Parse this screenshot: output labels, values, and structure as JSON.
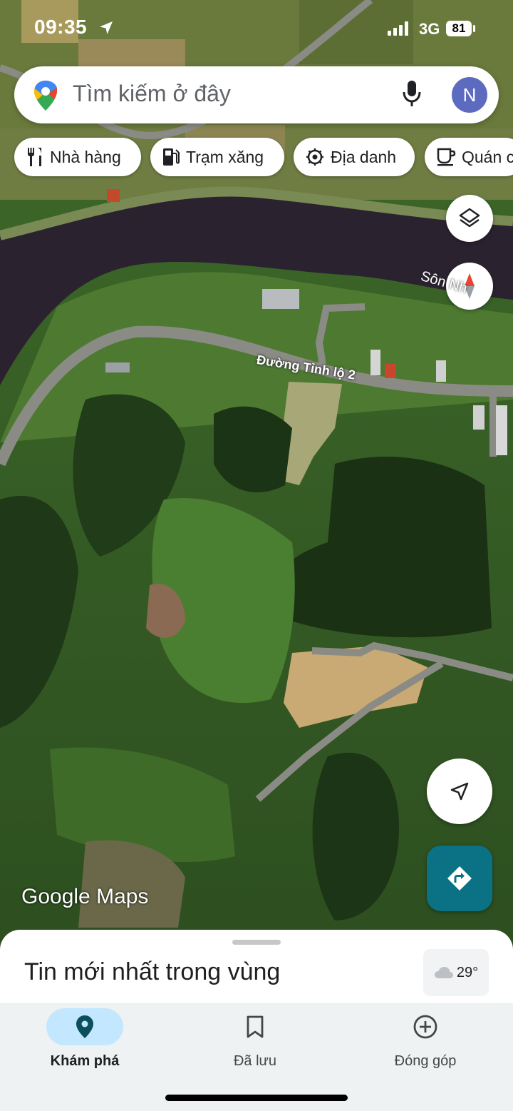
{
  "status_bar": {
    "time": "09:35",
    "network": "3G",
    "battery": "81",
    "location_icon": "location-arrow-icon",
    "signal_icon": "cellular-signal-icon"
  },
  "search": {
    "placeholder": "Tìm kiếm ở đây",
    "avatar_initial": "N",
    "logo_icon": "google-maps-pin-icon",
    "mic_icon": "microphone-icon"
  },
  "chips": [
    {
      "label": "Nhà hàng",
      "icon": "restaurant-icon"
    },
    {
      "label": "Trạm xăng",
      "icon": "gas-station-icon"
    },
    {
      "label": "Địa danh",
      "icon": "landmark-icon"
    },
    {
      "label": "Quán c",
      "icon": "coffee-icon"
    }
  ],
  "map": {
    "street_label": "Đường Tỉnh lộ 2",
    "river_label": "Sôn    Nh",
    "watermark": "Google Maps",
    "layers_icon": "layers-icon",
    "compass_icon": "compass-icon",
    "my_location_icon": "navigation-arrow-icon",
    "directions_icon": "directions-icon"
  },
  "bottom_sheet": {
    "title": "Tin mới nhất trong vùng",
    "weather_temp": "29°",
    "weather_icon": "cloud-icon"
  },
  "nav": {
    "items": [
      {
        "label": "Khám phá",
        "icon": "explore-pin-icon",
        "active": true
      },
      {
        "label": "Đã lưu",
        "icon": "bookmark-icon",
        "active": false
      },
      {
        "label": "Đóng góp",
        "icon": "add-circle-icon",
        "active": false
      }
    ]
  },
  "colors": {
    "accent_blue": "#0b57d0",
    "directions_teal": "#0b7285",
    "active_pill": "#c2e7ff",
    "avatar": "#5c6bc0"
  }
}
